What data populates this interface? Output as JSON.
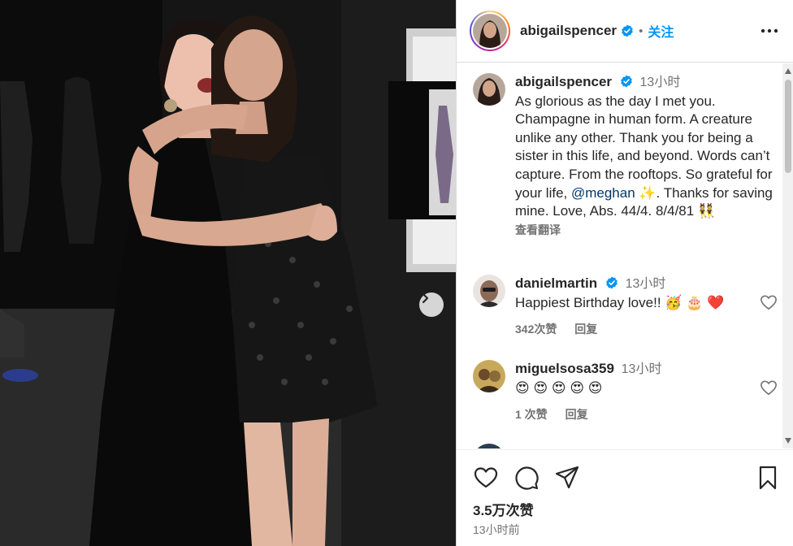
{
  "post": {
    "author": "abigailspencer",
    "follow_label": "关注",
    "dot": "•",
    "caption": {
      "username": "abigailspencer",
      "time": "13小时",
      "text_before": "As glorious as the day I met you. Champagne in human form. A creature unlike any other. Thank you for being a sister in this life, and beyond. Words can’t capture. From the rooftops. So grateful for your life, ",
      "mention": "@meghan",
      "text_after": " ✨. Thanks for saving mine. Love, Abs. 44/4. 8/4/81 👯",
      "translate_label": "查看翻译"
    },
    "comments": [
      {
        "username": "danielmartin",
        "verified": true,
        "time": "13小时",
        "text": "Happiest Birthday love!! 🥳 🎂 ❤️",
        "likes": "342次赞",
        "reply_label": "回复"
      },
      {
        "username": "miguelsosa359",
        "verified": false,
        "time": "13小时",
        "text": "😍 😍 😍 😍 😍",
        "likes": "1 次赞",
        "reply_label": "回复"
      }
    ],
    "likes_total": "3.5万次赞",
    "posted_ago": "13小时前"
  },
  "icons": {
    "verified": "verified-badge-icon",
    "more": "more-options-icon",
    "like": "heart-icon",
    "comment": "comment-icon",
    "share": "share-icon",
    "save": "bookmark-icon",
    "next": "chevron-right-icon"
  },
  "colors": {
    "accent": "#0095f6",
    "verified": "#0095f6",
    "mention": "#00376b",
    "muted": "#737373",
    "text": "#262626"
  }
}
